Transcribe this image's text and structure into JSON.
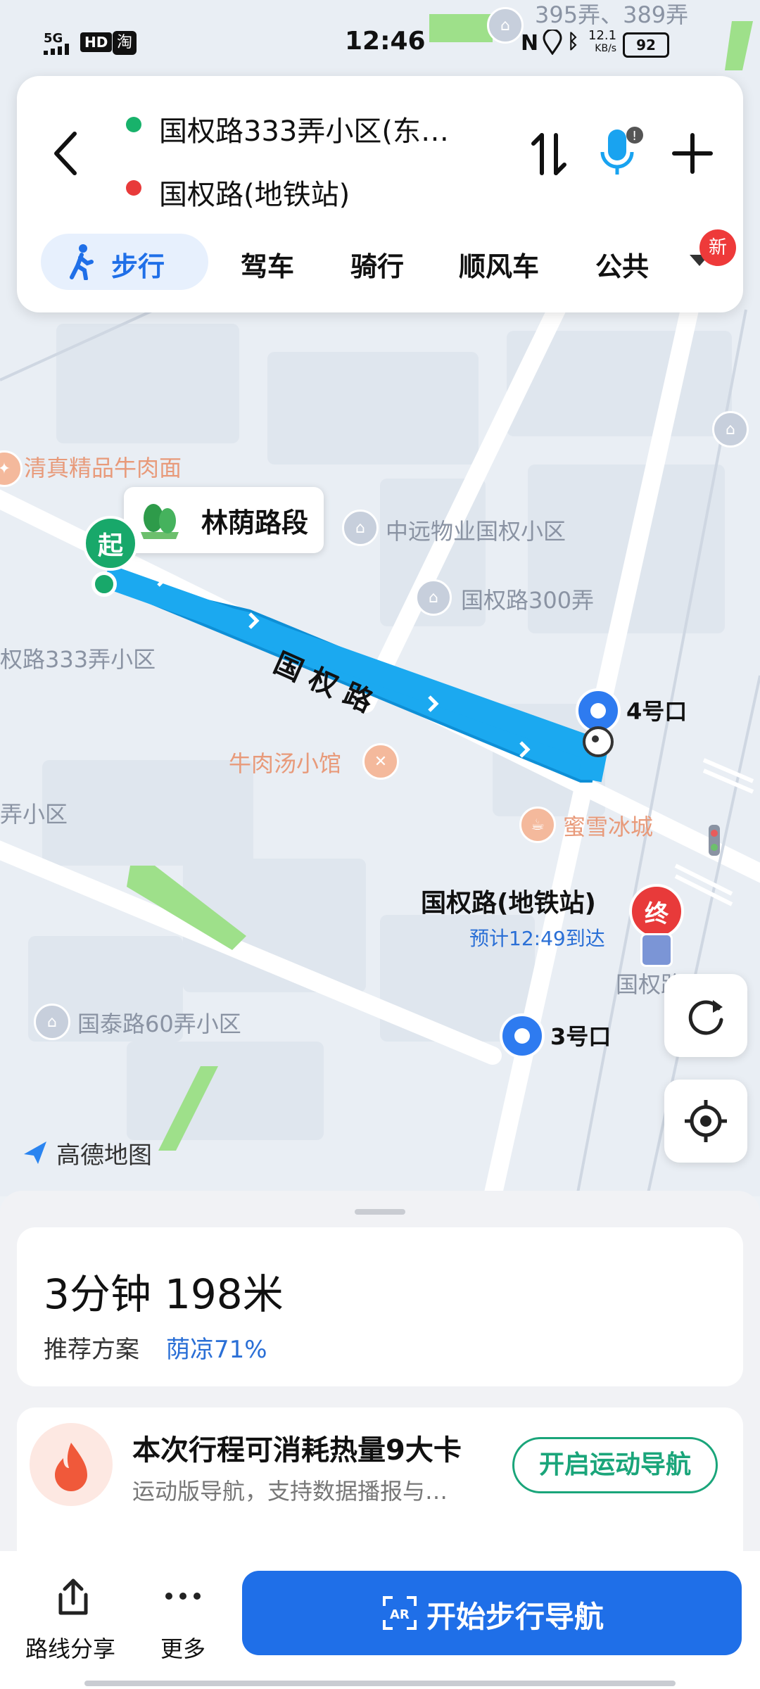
{
  "status_bar": {
    "time": "12:46",
    "network": "5G",
    "hd": "HD",
    "speed_value": "12.1",
    "speed_unit": "KB/s",
    "battery": "92"
  },
  "route": {
    "origin": "国权路333弄小区(东…",
    "destination": "国权路(地铁站)",
    "modes": [
      "步行",
      "驾车",
      "骑行",
      "顺风车",
      "公共"
    ],
    "new_badge": "新",
    "origin_color": "#18b26b",
    "destination_color": "#e83a3a",
    "accent": "#1f6fe8"
  },
  "map": {
    "labels": {
      "top_street": "395弄、389弄",
      "halal": "清真精品牛肉面",
      "shade": "林荫路段",
      "zhongyuan": "中远物业国权小区",
      "guoquan300": "国权路300弄",
      "guoquan333": "权路333弄小区",
      "road": "国权路",
      "exit4": "4号口",
      "beef_soup": "牛肉汤小馆",
      "mixue": "蜜雪冰城",
      "left_lane": "弄小区",
      "station": "国权路(地铁站)",
      "eta": "预计12:49到达",
      "station_short": "国权路",
      "exit3": "3号口",
      "guotai60": "国泰路60弄小区",
      "amap": "高德地图",
      "start_badge": "起",
      "end_badge": "终"
    }
  },
  "summary": {
    "duration": "3分钟",
    "distance": "198米",
    "recommend": "推荐方案",
    "shade_ratio": "荫凉71%"
  },
  "calorie": {
    "title": "本次行程可消耗热量9大卡",
    "subtitle": "运动版导航，支持数据播报与…",
    "button": "开启运动导航"
  },
  "bottom": {
    "share": "路线分享",
    "more": "更多",
    "start_nav": "开始步行导航"
  }
}
